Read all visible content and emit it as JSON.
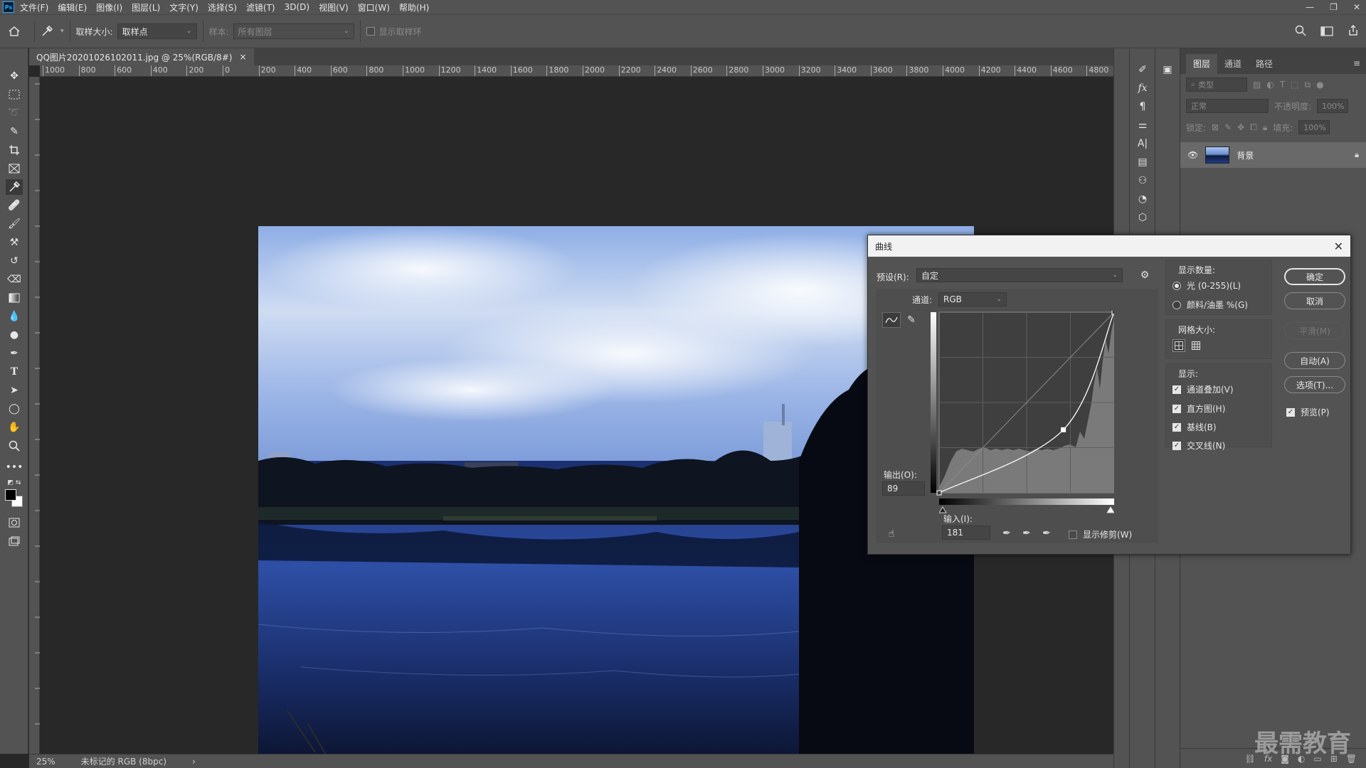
{
  "app": {
    "logo": "Ps"
  },
  "menu": [
    "文件(F)",
    "编辑(E)",
    "图像(I)",
    "图层(L)",
    "文字(Y)",
    "选择(S)",
    "滤镜(T)",
    "3D(D)",
    "视图(V)",
    "窗口(W)",
    "帮助(H)"
  ],
  "window_controls": [
    "—",
    "❐",
    "✕"
  ],
  "options_bar": {
    "sample_size_label": "取样大小:",
    "sample_size_value": "取样点",
    "sample_label": "样本:",
    "sample_value": "所有图层",
    "show_ring_label": "显示取样环"
  },
  "document": {
    "tab_title": "QQ图片20201026102011.jpg @ 25%(RGB/8#)",
    "tab_close": "×",
    "ruler_h": [
      "1000",
      "800",
      "600",
      "400",
      "200",
      "0",
      "200",
      "400",
      "600",
      "800",
      "1000",
      "1200",
      "1400",
      "1600",
      "1800",
      "2000",
      "2200",
      "2400",
      "2600",
      "2800",
      "3000",
      "3200",
      "3400",
      "3600",
      "3800",
      "4000",
      "4200",
      "4400",
      "4600",
      "4800",
      "5"
    ]
  },
  "status": {
    "zoom": "25%",
    "profile": "未标记的 RGB (8bpc)",
    "arrow": "›"
  },
  "layers_panel": {
    "tabs": [
      "图层",
      "通道",
      "路径"
    ],
    "filter_placeholder": "类型",
    "blend_mode": "正常",
    "opacity_label": "不透明度:",
    "opacity_value": "100%",
    "lock_label": "锁定:",
    "fill_label": "填充:",
    "fill_value": "100%",
    "layer_name": "背景"
  },
  "curves": {
    "title": "曲线",
    "preset_label": "预设(R):",
    "preset_value": "自定",
    "channel_label": "通道:",
    "channel_value": "RGB",
    "output_label": "输出(O):",
    "output_value": "89",
    "input_label": "输入(I):",
    "input_value": "181",
    "show_clipping_label": "显示修剪(W)",
    "show_amount_label": "显示数量:",
    "light_label": "光 (0-255)(L)",
    "pigment_label": "颜料/油墨 %(G)",
    "grid_size_label": "网格大小:",
    "show_label": "显示:",
    "channel_overlay_label": "通道叠加(V)",
    "histogram_label": "直方图(H)",
    "baseline_label": "基线(B)",
    "intersection_label": "交叉线(N)",
    "ok_label": "确定",
    "cancel_label": "取消",
    "smooth_label": "平滑(M)",
    "auto_label": "自动(A)",
    "options_label": "选项(T)...",
    "preview_label": "预览(P)",
    "curve_points": [
      [
        0,
        0
      ],
      [
        181,
        89
      ],
      [
        255,
        255
      ]
    ]
  },
  "watermark": "最需教育",
  "colors": {
    "panel": "#535353",
    "canvas_bg": "#282828",
    "accent": "#31a8ff"
  }
}
